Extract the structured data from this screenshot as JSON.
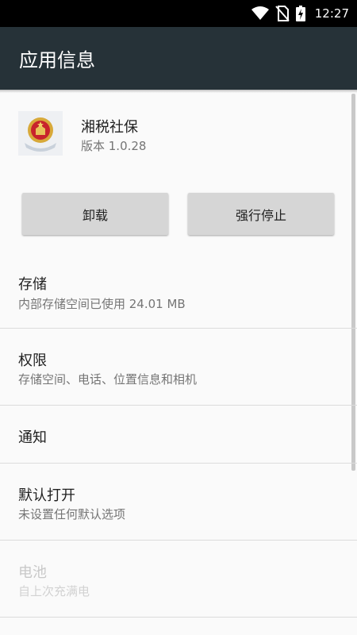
{
  "status_bar": {
    "time": "12:27",
    "icons": [
      "wifi-icon",
      "no-sim-icon",
      "battery-charging-icon"
    ]
  },
  "app_bar": {
    "title": "应用信息"
  },
  "app": {
    "name": "湘税社保",
    "version": "版本 1.0.28",
    "icon": "national-emblem-icon"
  },
  "buttons": {
    "uninstall": "卸载",
    "force_stop": "强行停止"
  },
  "items": [
    {
      "title": "存储",
      "subtitle": "内部存储空间已使用 24.01 MB"
    },
    {
      "title": "权限",
      "subtitle": "存储空间、电话、位置信息和相机"
    },
    {
      "title": "通知",
      "subtitle": ""
    },
    {
      "title": "默认打开",
      "subtitle": "未设置任何默认选项"
    },
    {
      "title": "电池",
      "subtitle": "自上次充满电"
    }
  ],
  "colors": {
    "app_bar": "#263238",
    "status_bar": "#000000",
    "background": "#fafafa",
    "button": "#d6d6d6"
  }
}
